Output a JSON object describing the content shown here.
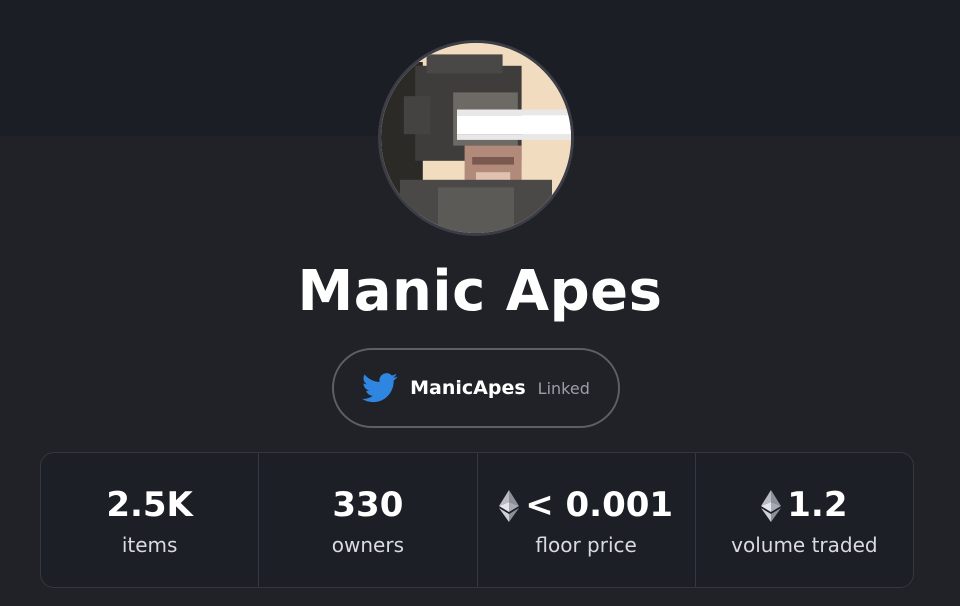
{
  "collection": {
    "name": "Manic Apes",
    "avatar_icon": "ape-laser-eyes-avatar"
  },
  "twitter": {
    "icon": "twitter-bird-icon",
    "handle": "ManicApes",
    "status": "Linked",
    "icon_color": "#2f86e0"
  },
  "stats": [
    {
      "value": "2.5K",
      "label": "items",
      "eth": false
    },
    {
      "value": "330",
      "label": "owners",
      "eth": false
    },
    {
      "value": "< 0.001",
      "label": "floor price",
      "eth": true
    },
    {
      "value": "1.2",
      "label": "volume traded",
      "eth": true
    }
  ],
  "colors": {
    "background": "#202228",
    "banner": "#1b1e25",
    "border": "#34373f"
  }
}
